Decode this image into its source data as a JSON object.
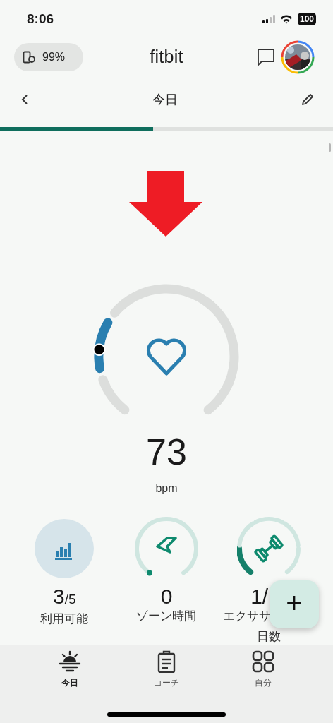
{
  "status_bar": {
    "time": "8:06",
    "battery": "100"
  },
  "header": {
    "device_battery": "99%",
    "logo": "fitbit"
  },
  "date_nav": {
    "title": "今日"
  },
  "day_progress": {
    "level": 0.46
  },
  "heart_rate": {
    "value": "73",
    "unit": "bpm"
  },
  "stats": [
    {
      "kind": "badge",
      "value": "3",
      "total": "/5",
      "label_lines": [
        "利用可能"
      ]
    },
    {
      "kind": "ring",
      "value": "0",
      "label_lines": [
        "ゾーン時間"
      ]
    },
    {
      "kind": "segmented",
      "value": "1/",
      "label_lines": [
        "エクササ",
        "日数"
      ]
    }
  ],
  "fab": {
    "label": "+"
  },
  "bottom_nav": [
    {
      "kind": "sun",
      "label": "今日",
      "selected": true
    },
    {
      "kind": "clipboard",
      "label": "コーチ",
      "selected": false
    },
    {
      "kind": "grid",
      "label": "自分",
      "selected": false
    }
  ]
}
